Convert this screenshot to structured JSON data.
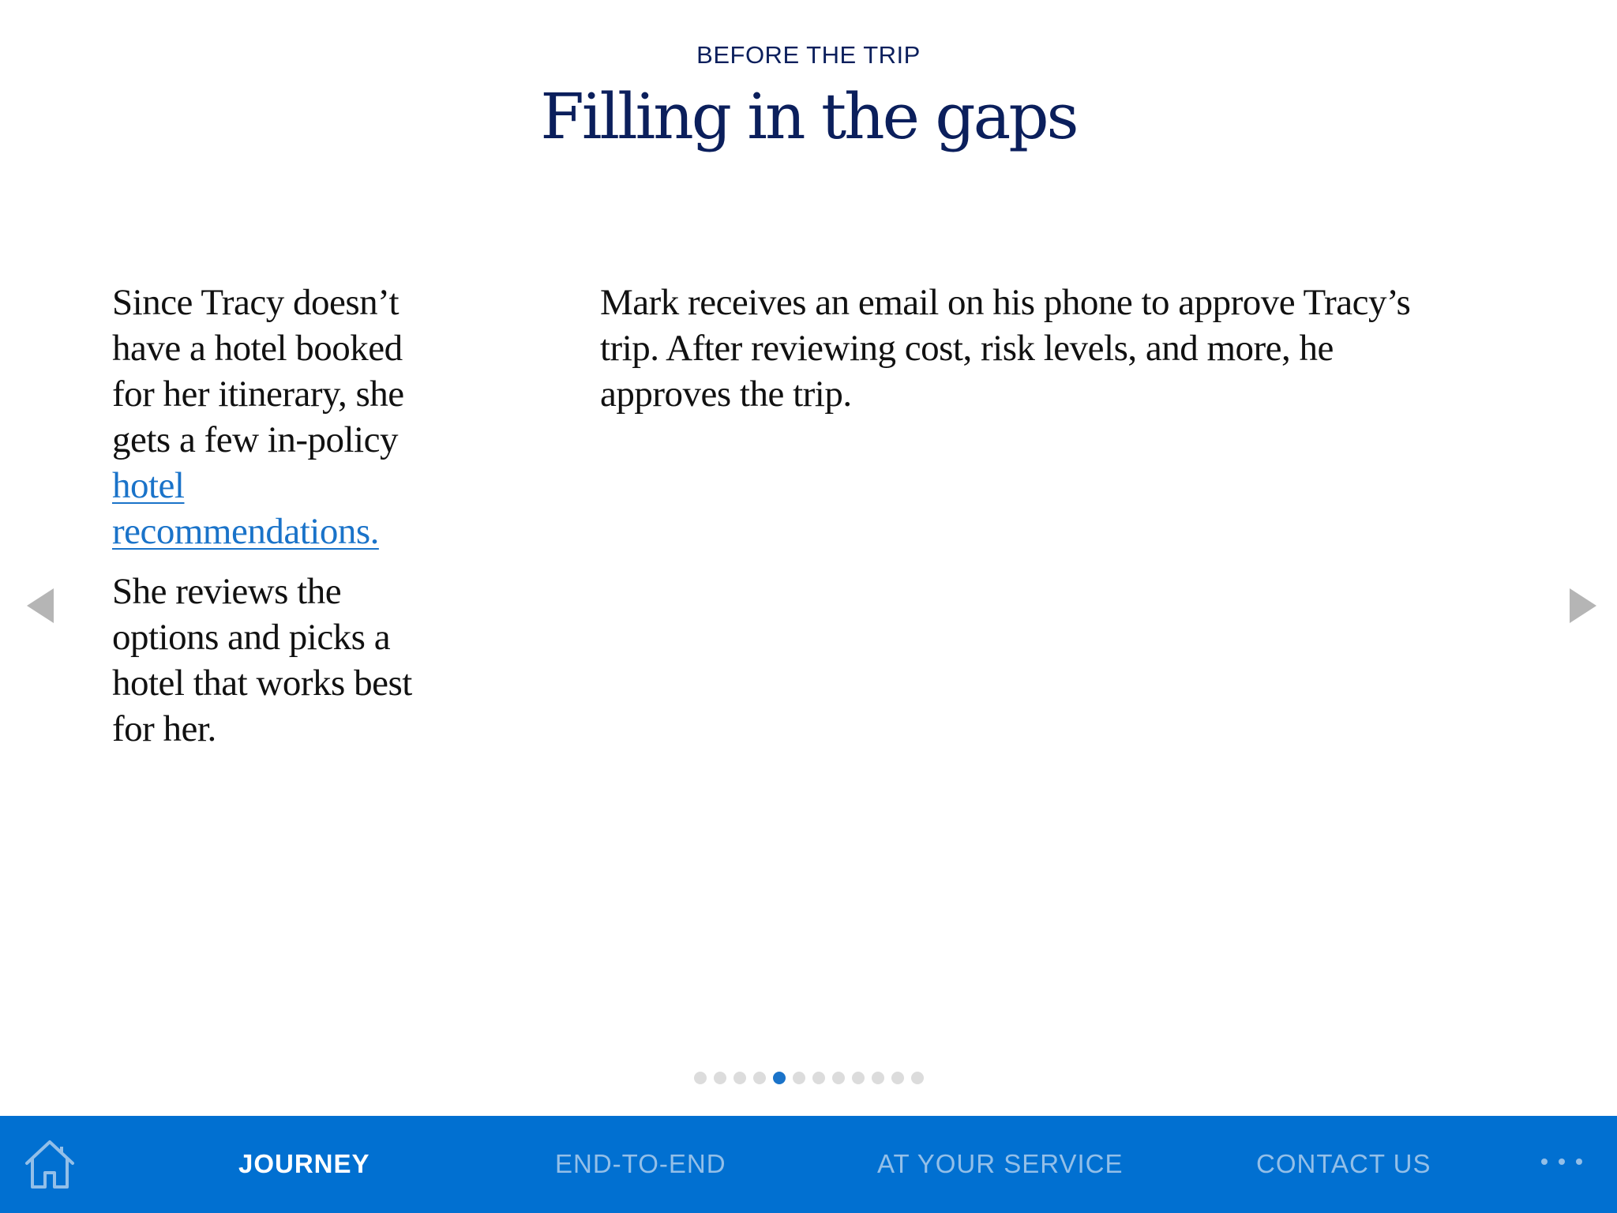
{
  "header": {
    "eyebrow": "BEFORE THE TRIP",
    "title": "Filling in the gaps"
  },
  "left_column": {
    "paragraph1_text": "Since Tracy doesn’t have a hotel booked for her itinerary, she gets a few in-policy ",
    "paragraph1_link": "hotel recommendations.",
    "paragraph2": "She reviews the options and picks a hotel that works best for her."
  },
  "right_column": {
    "paragraph": "Mark receives an email on his phone to approve Tracy’s trip. After reviewing cost, risk levels, and more, he approves the trip."
  },
  "navigation": {
    "prev_icon": "triangle-left-icon",
    "next_icon": "triangle-right-icon"
  },
  "pagination": {
    "total": 12,
    "current": 5
  },
  "navbar": {
    "home_icon": "home-icon",
    "items": [
      {
        "label": "JOURNEY",
        "active": true
      },
      {
        "label": "END-TO-END",
        "active": false
      },
      {
        "label": "AT YOUR SERVICE",
        "active": false
      },
      {
        "label": "CONTACT US",
        "active": false
      }
    ],
    "more_icon": "more-dots-icon"
  },
  "colors": {
    "navbar_bg": "#0170d1",
    "title": "#0b1f5c",
    "link": "#1a73c9",
    "active_dot": "#1a73c9",
    "inactive_nav": "#93bfe8"
  }
}
